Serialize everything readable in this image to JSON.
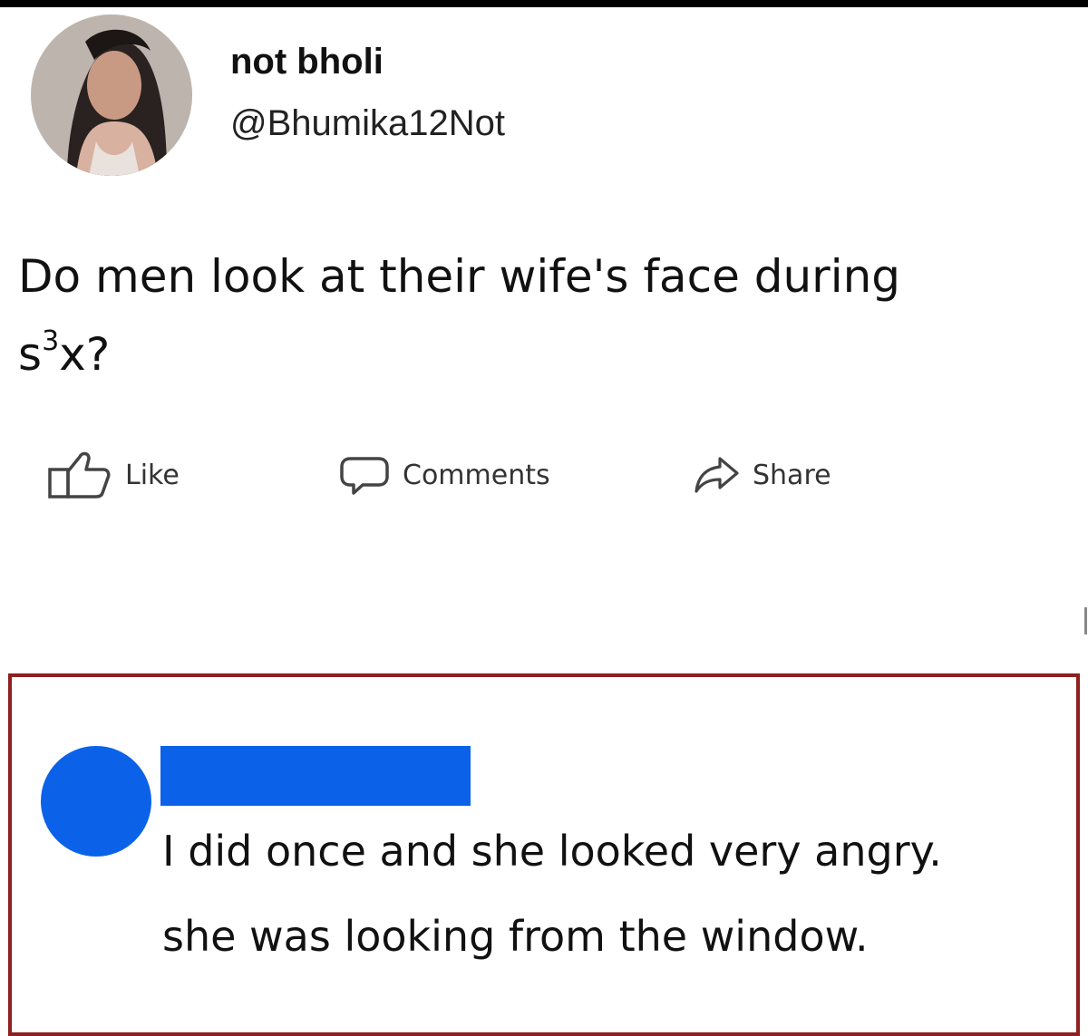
{
  "post": {
    "author": {
      "display_name": "not bholi",
      "handle": "@Bhumika12Not"
    },
    "text": {
      "line1": "Do men look at their wife's face during",
      "line2_prefix": "s",
      "line2_superscript": "3",
      "line2_suffix": "x?"
    }
  },
  "actions": {
    "like": {
      "label": "Like",
      "icon": "thumbs-up-icon"
    },
    "comments": {
      "label": "Comments",
      "icon": "comment-bubble-icon"
    },
    "share": {
      "label": "Share",
      "icon": "share-arrow-icon"
    }
  },
  "reply": {
    "line1": "I did once and she looked very angry.",
    "line2": "she was looking from the window.",
    "redaction_color": "#0b62e8",
    "border_color": "#8e2020"
  }
}
